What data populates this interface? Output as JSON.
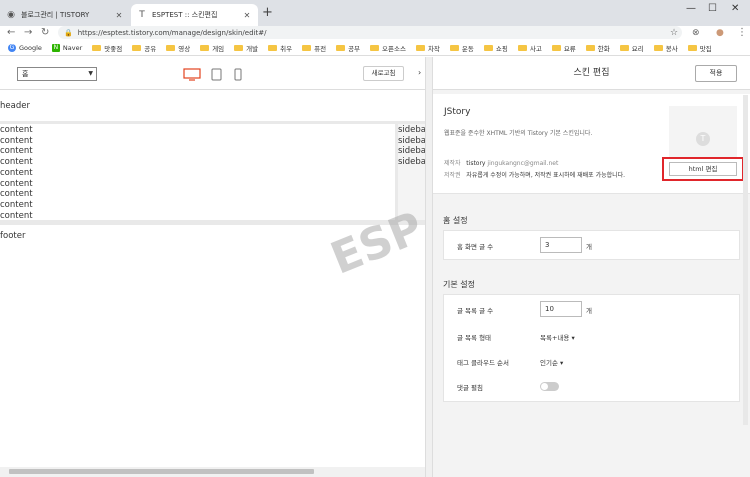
{
  "browser": {
    "tabs": [
      {
        "title": "블로그관리 | TISTORY"
      },
      {
        "title": "ESPTEST :: 스킨편집"
      }
    ],
    "url": "https://esptest.tistory.com/manage/design/skin/edit#/",
    "bookmarks": [
      "Google",
      "Naver",
      "맛좋점",
      "공유",
      "영상",
      "게임",
      "개발",
      "취우",
      "퓨전",
      "공부",
      "오픈소스",
      "차작",
      "운동",
      "쇼핑",
      "사고",
      "요류",
      "한화",
      "요리",
      "봉사",
      "맛집"
    ]
  },
  "left": {
    "page_select": "홈",
    "refresh_label": "새로고침",
    "preview": {
      "header": "header",
      "content_lines": [
        "content",
        "content",
        "content",
        "content",
        "content",
        "content",
        "content",
        "content",
        "content",
        "content"
      ],
      "sidebar_lines": [
        "sidebar",
        "sidebar",
        "sidebar",
        "sidebar"
      ],
      "footer": "footer"
    },
    "watermark": "ESP"
  },
  "right": {
    "title": "스킨 편집",
    "apply_label": "적용",
    "skin": {
      "name": "JStory",
      "description": "웹표준을 준수한 XHTML 기반의 Tistory 기본 스킨입니다.",
      "maker_label": "제작자",
      "maker": "tistory",
      "maker_email": "jingukangnc@gmail.net",
      "license_label": "저작권",
      "license": "자유롭게 수정이 가능하며, 저작권 표시하에 재배포 가능합니다.",
      "html_edit_label": "html 편집"
    },
    "home_settings": {
      "title": "홈 설정",
      "posts_label": "홈 화면 글 수",
      "posts_value": "3",
      "posts_unit": "개"
    },
    "basic_settings": {
      "title": "기본 설정",
      "list_count_label": "글 목록 글 수",
      "list_count_value": "10",
      "list_count_unit": "개",
      "list_type_label": "글 목록 형태",
      "list_type_value": "목록+내용",
      "tag_order_label": "태그 클라우드 순서",
      "tag_order_value": "인기순",
      "comment_fold_label": "댓글 펼침",
      "comment_fold_on": false
    }
  }
}
